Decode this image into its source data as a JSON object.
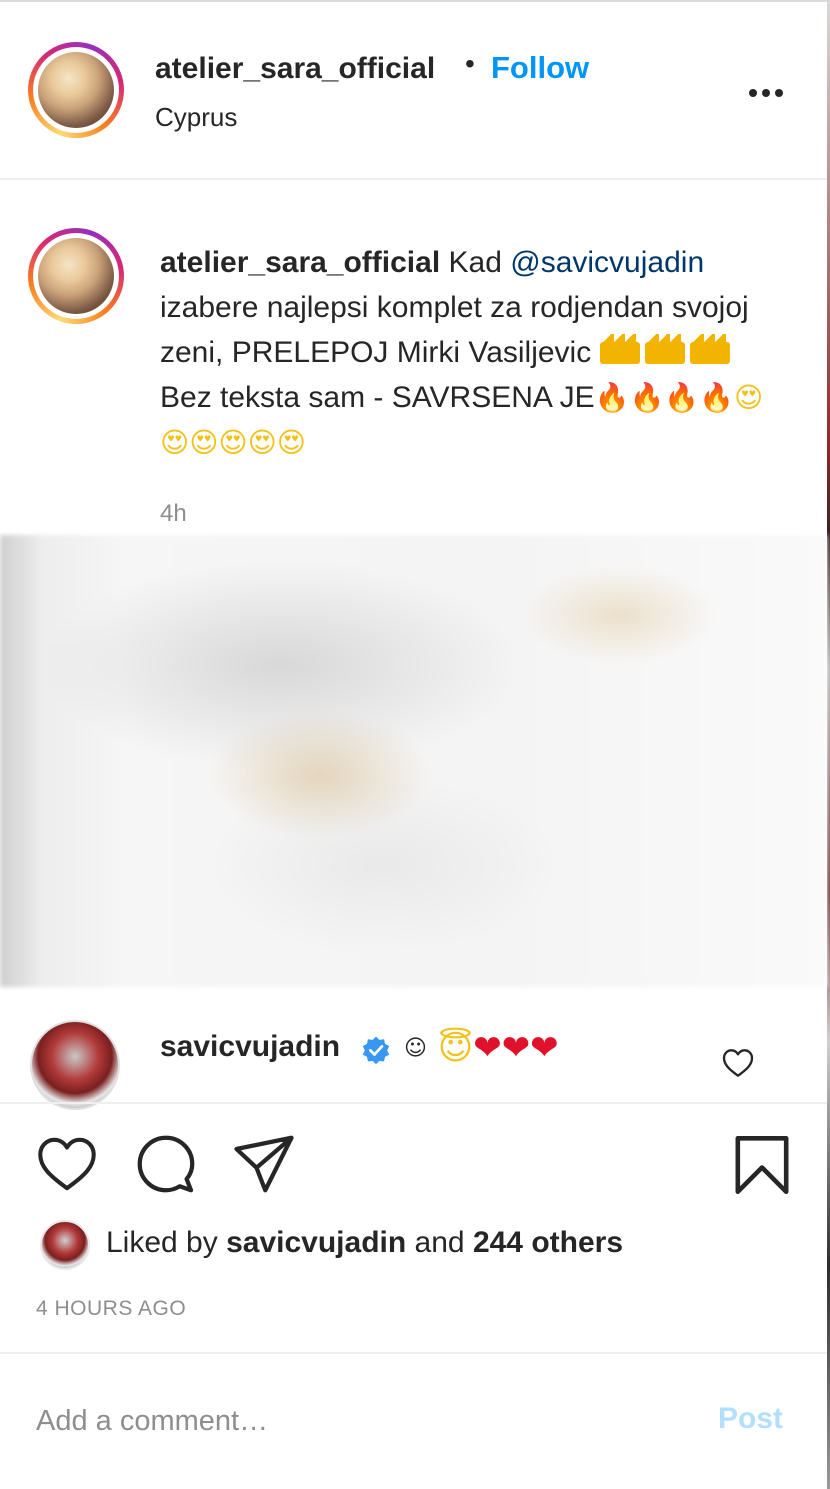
{
  "header": {
    "username": "atelier_sara_official",
    "separator": "•",
    "follow_label": "Follow",
    "location": "Cyprus",
    "more_icon": "more-horizontal-icon"
  },
  "caption": {
    "username": "atelier_sara_official",
    "text_before_mention": "Kad",
    "mention": "@savicvujadin",
    "text_after_mention": "izabere najlepsi komplet za rodjendan svojoj zeni, PRELEPOJ Mirki Vasiljevic",
    "crown_count": 3,
    "text_after_crowns": "Bez teksta sam - SAVRSENA JE",
    "fire_emojis": "🔥🔥🔥🔥",
    "heart_eye_emojis": "😍😍😍😍😍😍",
    "time_short": "4h"
  },
  "comment": {
    "username": "savicvujadin",
    "verified": true,
    "small_face": "☺",
    "angel_face": "😇",
    "hearts": "❤❤❤"
  },
  "actions": {
    "like_icon": "heart-outline-icon",
    "comment_icon": "comment-bubble-icon",
    "share_icon": "paper-plane-icon",
    "save_icon": "bookmark-icon"
  },
  "likes": {
    "prefix": "Liked by",
    "username": "savicvujadin",
    "conjunction": "and",
    "others": "244 others"
  },
  "time_ago": "4 HOURS AGO",
  "comment_box": {
    "placeholder": "Add a comment…",
    "post_label": "Post"
  },
  "colors": {
    "follow_blue": "#0095f6",
    "mention_blue": "#00376b",
    "post_disabled": "#b2dffc",
    "secondary_text": "#8e8e8e",
    "verified_blue": "#3897f0"
  }
}
